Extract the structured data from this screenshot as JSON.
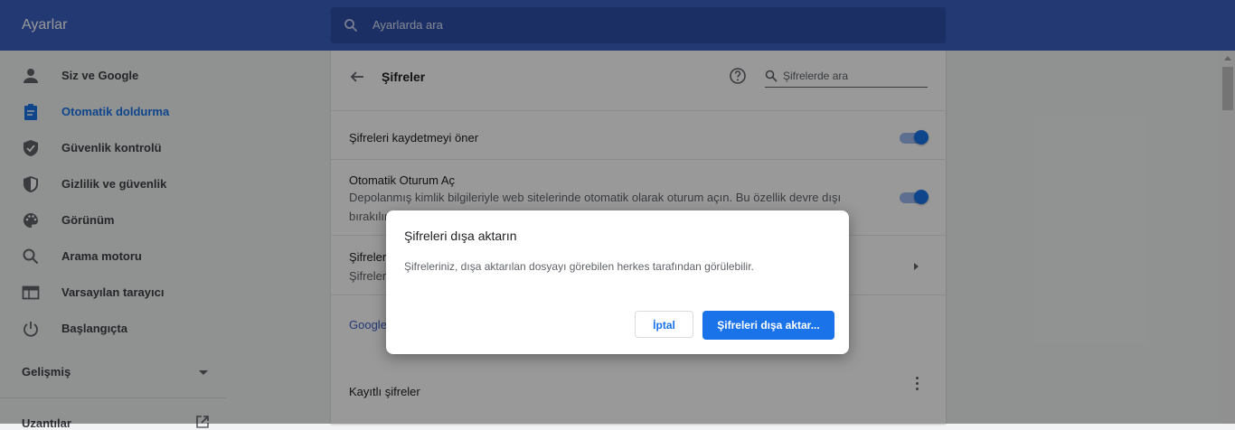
{
  "app": {
    "title": "Ayarlar"
  },
  "search": {
    "placeholder": "Ayarlarda ara"
  },
  "sidebar": {
    "items": [
      {
        "label": "Siz ve Google",
        "icon": "person-icon"
      },
      {
        "label": "Otomatik doldurma",
        "icon": "clipboard-icon",
        "active": true
      },
      {
        "label": "Güvenlik kontrolü",
        "icon": "shield-check-icon"
      },
      {
        "label": "Gizlilik ve güvenlik",
        "icon": "shield-icon"
      },
      {
        "label": "Görünüm",
        "icon": "palette-icon"
      },
      {
        "label": "Arama motoru",
        "icon": "search-icon"
      },
      {
        "label": "Varsayılan tarayıcı",
        "icon": "browser-icon"
      },
      {
        "label": "Başlangıçta",
        "icon": "power-icon"
      }
    ],
    "advanced": "Gelişmiş",
    "extensions": "Uzantılar"
  },
  "passwords": {
    "title": "Şifreler",
    "search_placeholder": "Şifrelerde ara",
    "offer_save": {
      "label": "Şifreleri kaydetmeyi öner",
      "enabled": true
    },
    "auto_signin": {
      "label": "Otomatik Oturum Aç",
      "desc_line1": "Depolanmış kimlik bilgileriyle web sitelerinde otomatik olarak oturum açın. Bu özellik devre dışı",
      "desc_line2": "bırakılırsa",
      "enabled": true
    },
    "check": {
      "label": "Şifreler",
      "sub": "Şifreler"
    },
    "google_link": "Google",
    "saved_label": "Kayıtlı şifreler"
  },
  "dialog": {
    "title": "Şifreleri dışa aktarın",
    "body": "Şifreleriniz, dışa aktarılan dosyayı görebilen herkes tarafından görülebilir.",
    "cancel": "İptal",
    "confirm": "Şifreleri dışa aktar..."
  },
  "colors": {
    "header": "#3b5fc0",
    "accent": "#1a73e8"
  }
}
